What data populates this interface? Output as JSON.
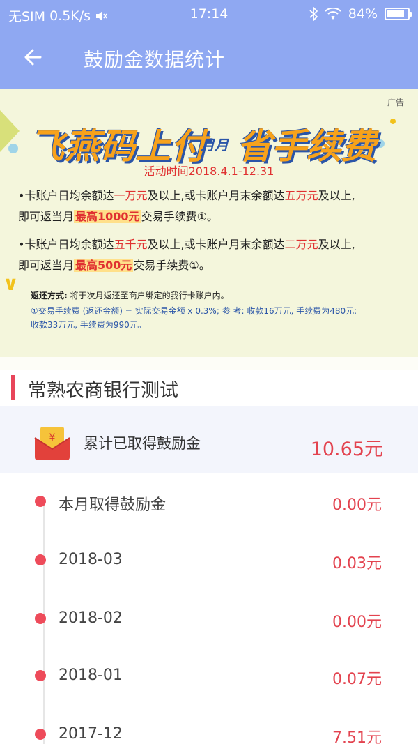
{
  "status_bar": {
    "carrier": "无SIM",
    "speed": "0.5K/s",
    "time": "17:14",
    "battery": "84%",
    "battery_level": 0.84
  },
  "header": {
    "title": "鼓励金数据统计"
  },
  "ad": {
    "tag": "广告",
    "headline_a": "飞燕码上付",
    "headline_b": "月月",
    "headline_c": "省手续费",
    "period": "活动时间2018.4.1-12.31",
    "p1": {
      "t1": "•卡账户日均余额达",
      "r1": "一万元",
      "t2": "及以上,或卡账户月末余额达",
      "r2": "五万元",
      "t3": "及以上,",
      "t4": "即可返当月",
      "h1": "最高1000元",
      "t5": "交易手续费①。"
    },
    "p2": {
      "t1": "•卡账户日均余额达",
      "r1": "五千元",
      "t2": "及以上,或卡账户月末余额达",
      "r2": "二万元",
      "t3": "及以上,",
      "t4": "即可返当月",
      "h1": "最高500元",
      "t5": "交易手续费①。"
    },
    "note_label": "返还方式:",
    "note_text": "将于次月返还至商户绑定的我行卡账户内。",
    "note2": "①交易手续费 (返还金额) = 实际交易金额 x 0.3%; 参 考: 收款16万元, 手续费为480元;",
    "note3": "收款33万元, 手续费为990元。"
  },
  "bank": {
    "name": "常熟农商银行测试"
  },
  "summary": {
    "label": "累计已取得鼓励金",
    "value": "10.65元"
  },
  "timeline": [
    {
      "label": "本月取得鼓励金",
      "value": "0.00元"
    },
    {
      "label": "2018-03",
      "value": "0.03元"
    },
    {
      "label": "2018-02",
      "value": "0.00元"
    },
    {
      "label": "2018-01",
      "value": "0.07元"
    },
    {
      "label": "2017-12",
      "value": "7.51元"
    }
  ],
  "colors": {
    "header": "#8fa8f2",
    "accent_red": "#e3434f",
    "summary_bg": "#f3f5fc"
  },
  "icons": {
    "back": "arrow-left-icon",
    "red_envelope": "red-envelope-icon"
  }
}
